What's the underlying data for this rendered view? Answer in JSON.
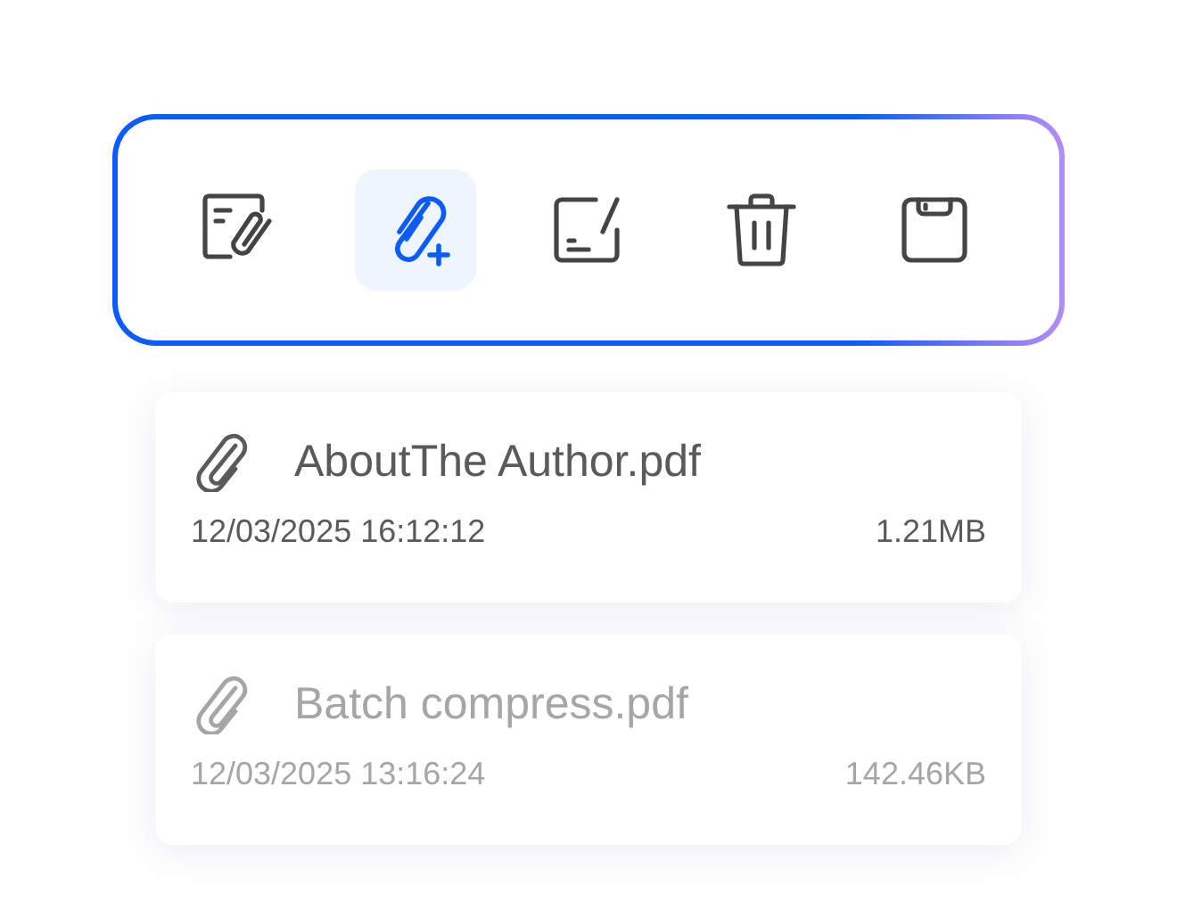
{
  "toolbar": {
    "tools": [
      {
        "kind": "attachments",
        "selected": false
      },
      {
        "kind": "add-attachment",
        "selected": true
      },
      {
        "kind": "sign",
        "selected": false
      },
      {
        "kind": "delete",
        "selected": false
      },
      {
        "kind": "save",
        "selected": false
      }
    ]
  },
  "files": [
    {
      "name": "AboutThe Author.pdf",
      "date": "12/03/2025 16:12:12",
      "size": "1.21MB",
      "disabled": false
    },
    {
      "name": "Batch compress.pdf",
      "date": "12/03/2025 13:16:24",
      "size": "142.46KB",
      "disabled": true
    }
  ]
}
